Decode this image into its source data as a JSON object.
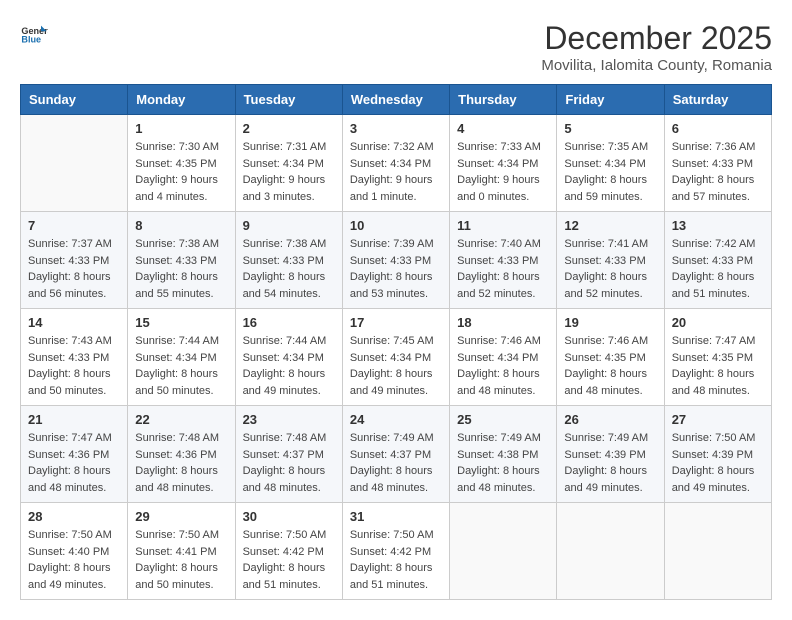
{
  "header": {
    "logo_general": "General",
    "logo_blue": "Blue",
    "month": "December 2025",
    "location": "Movilita, Ialomita County, Romania"
  },
  "weekdays": [
    "Sunday",
    "Monday",
    "Tuesday",
    "Wednesday",
    "Thursday",
    "Friday",
    "Saturday"
  ],
  "weeks": [
    [
      {
        "day": "",
        "info": ""
      },
      {
        "day": "1",
        "info": "Sunrise: 7:30 AM\nSunset: 4:35 PM\nDaylight: 9 hours\nand 4 minutes."
      },
      {
        "day": "2",
        "info": "Sunrise: 7:31 AM\nSunset: 4:34 PM\nDaylight: 9 hours\nand 3 minutes."
      },
      {
        "day": "3",
        "info": "Sunrise: 7:32 AM\nSunset: 4:34 PM\nDaylight: 9 hours\nand 1 minute."
      },
      {
        "day": "4",
        "info": "Sunrise: 7:33 AM\nSunset: 4:34 PM\nDaylight: 9 hours\nand 0 minutes."
      },
      {
        "day": "5",
        "info": "Sunrise: 7:35 AM\nSunset: 4:34 PM\nDaylight: 8 hours\nand 59 minutes."
      },
      {
        "day": "6",
        "info": "Sunrise: 7:36 AM\nSunset: 4:33 PM\nDaylight: 8 hours\nand 57 minutes."
      }
    ],
    [
      {
        "day": "7",
        "info": "Sunrise: 7:37 AM\nSunset: 4:33 PM\nDaylight: 8 hours\nand 56 minutes."
      },
      {
        "day": "8",
        "info": "Sunrise: 7:38 AM\nSunset: 4:33 PM\nDaylight: 8 hours\nand 55 minutes."
      },
      {
        "day": "9",
        "info": "Sunrise: 7:38 AM\nSunset: 4:33 PM\nDaylight: 8 hours\nand 54 minutes."
      },
      {
        "day": "10",
        "info": "Sunrise: 7:39 AM\nSunset: 4:33 PM\nDaylight: 8 hours\nand 53 minutes."
      },
      {
        "day": "11",
        "info": "Sunrise: 7:40 AM\nSunset: 4:33 PM\nDaylight: 8 hours\nand 52 minutes."
      },
      {
        "day": "12",
        "info": "Sunrise: 7:41 AM\nSunset: 4:33 PM\nDaylight: 8 hours\nand 52 minutes."
      },
      {
        "day": "13",
        "info": "Sunrise: 7:42 AM\nSunset: 4:33 PM\nDaylight: 8 hours\nand 51 minutes."
      }
    ],
    [
      {
        "day": "14",
        "info": "Sunrise: 7:43 AM\nSunset: 4:33 PM\nDaylight: 8 hours\nand 50 minutes."
      },
      {
        "day": "15",
        "info": "Sunrise: 7:44 AM\nSunset: 4:34 PM\nDaylight: 8 hours\nand 50 minutes."
      },
      {
        "day": "16",
        "info": "Sunrise: 7:44 AM\nSunset: 4:34 PM\nDaylight: 8 hours\nand 49 minutes."
      },
      {
        "day": "17",
        "info": "Sunrise: 7:45 AM\nSunset: 4:34 PM\nDaylight: 8 hours\nand 49 minutes."
      },
      {
        "day": "18",
        "info": "Sunrise: 7:46 AM\nSunset: 4:34 PM\nDaylight: 8 hours\nand 48 minutes."
      },
      {
        "day": "19",
        "info": "Sunrise: 7:46 AM\nSunset: 4:35 PM\nDaylight: 8 hours\nand 48 minutes."
      },
      {
        "day": "20",
        "info": "Sunrise: 7:47 AM\nSunset: 4:35 PM\nDaylight: 8 hours\nand 48 minutes."
      }
    ],
    [
      {
        "day": "21",
        "info": "Sunrise: 7:47 AM\nSunset: 4:36 PM\nDaylight: 8 hours\nand 48 minutes."
      },
      {
        "day": "22",
        "info": "Sunrise: 7:48 AM\nSunset: 4:36 PM\nDaylight: 8 hours\nand 48 minutes."
      },
      {
        "day": "23",
        "info": "Sunrise: 7:48 AM\nSunset: 4:37 PM\nDaylight: 8 hours\nand 48 minutes."
      },
      {
        "day": "24",
        "info": "Sunrise: 7:49 AM\nSunset: 4:37 PM\nDaylight: 8 hours\nand 48 minutes."
      },
      {
        "day": "25",
        "info": "Sunrise: 7:49 AM\nSunset: 4:38 PM\nDaylight: 8 hours\nand 48 minutes."
      },
      {
        "day": "26",
        "info": "Sunrise: 7:49 AM\nSunset: 4:39 PM\nDaylight: 8 hours\nand 49 minutes."
      },
      {
        "day": "27",
        "info": "Sunrise: 7:50 AM\nSunset: 4:39 PM\nDaylight: 8 hours\nand 49 minutes."
      }
    ],
    [
      {
        "day": "28",
        "info": "Sunrise: 7:50 AM\nSunset: 4:40 PM\nDaylight: 8 hours\nand 49 minutes."
      },
      {
        "day": "29",
        "info": "Sunrise: 7:50 AM\nSunset: 4:41 PM\nDaylight: 8 hours\nand 50 minutes."
      },
      {
        "day": "30",
        "info": "Sunrise: 7:50 AM\nSunset: 4:42 PM\nDaylight: 8 hours\nand 51 minutes."
      },
      {
        "day": "31",
        "info": "Sunrise: 7:50 AM\nSunset: 4:42 PM\nDaylight: 8 hours\nand 51 minutes."
      },
      {
        "day": "",
        "info": ""
      },
      {
        "day": "",
        "info": ""
      },
      {
        "day": "",
        "info": ""
      }
    ]
  ]
}
